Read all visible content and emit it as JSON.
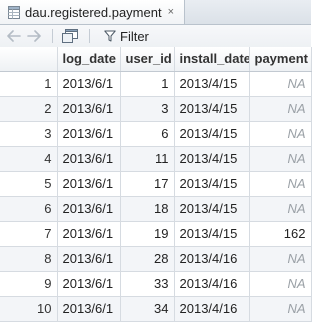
{
  "tab": {
    "title": "dau.registered.payment",
    "close_glyph": "×",
    "icon": "data-table-icon"
  },
  "toolbar": {
    "back_icon": "arrow-left-icon",
    "forward_icon": "arrow-right-icon",
    "popout_icon": "popout-window-icon",
    "filter_icon": "funnel-icon",
    "filter_label": "Filter"
  },
  "table": {
    "columns": [
      "log_date",
      "user_id",
      "install_date",
      "payment"
    ],
    "rows": [
      {
        "n": "1",
        "log_date": "2013/6/1",
        "user_id": "1",
        "install_date": "2013/4/15",
        "payment": "NA"
      },
      {
        "n": "2",
        "log_date": "2013/6/1",
        "user_id": "3",
        "install_date": "2013/4/15",
        "payment": "NA"
      },
      {
        "n": "3",
        "log_date": "2013/6/1",
        "user_id": "6",
        "install_date": "2013/4/15",
        "payment": "NA"
      },
      {
        "n": "4",
        "log_date": "2013/6/1",
        "user_id": "11",
        "install_date": "2013/4/15",
        "payment": "NA"
      },
      {
        "n": "5",
        "log_date": "2013/6/1",
        "user_id": "17",
        "install_date": "2013/4/15",
        "payment": "NA"
      },
      {
        "n": "6",
        "log_date": "2013/6/1",
        "user_id": "18",
        "install_date": "2013/4/15",
        "payment": "NA"
      },
      {
        "n": "7",
        "log_date": "2013/6/1",
        "user_id": "19",
        "install_date": "2013/4/15",
        "payment": "162"
      },
      {
        "n": "8",
        "log_date": "2013/6/1",
        "user_id": "28",
        "install_date": "2013/4/16",
        "payment": "NA"
      },
      {
        "n": "9",
        "log_date": "2013/6/1",
        "user_id": "33",
        "install_date": "2013/4/16",
        "payment": "NA"
      },
      {
        "n": "10",
        "log_date": "2013/6/1",
        "user_id": "34",
        "install_date": "2013/4/16",
        "payment": "NA"
      }
    ]
  },
  "colors": {
    "na_text": "#9aa0a6",
    "stripe": "#f3f5f8",
    "border": "#d6dbe1"
  }
}
